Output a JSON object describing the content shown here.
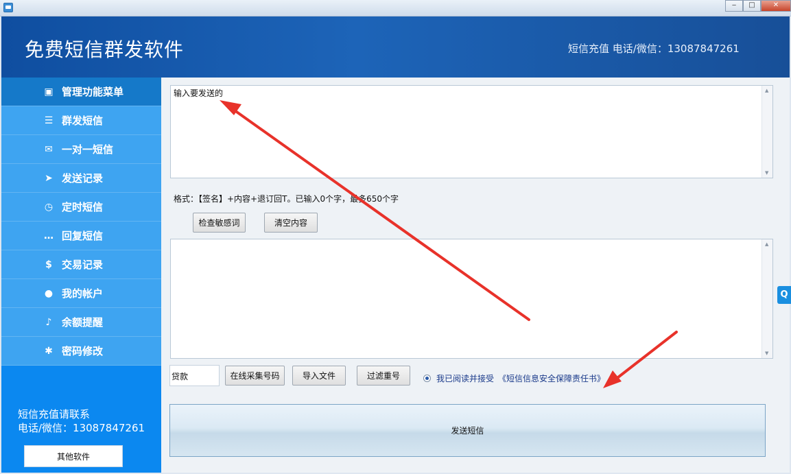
{
  "window": {
    "minimize_label": "‒",
    "maximize_label": "□",
    "close_label": "✕"
  },
  "header": {
    "title": "免费短信群发软件",
    "contact": "短信充值 电话/微信：13087847261"
  },
  "sidebar": {
    "items": [
      {
        "label": "管理功能菜单",
        "icon": "monitor-icon",
        "glyph": "▣"
      },
      {
        "label": "群发短信",
        "icon": "group-chat-icon",
        "glyph": "☰"
      },
      {
        "label": "一对一短信",
        "icon": "user-message-icon",
        "glyph": "✉"
      },
      {
        "label": "发送记录",
        "icon": "send-record-icon",
        "glyph": "➤"
      },
      {
        "label": "定时短信",
        "icon": "timer-icon",
        "glyph": "◷"
      },
      {
        "label": "回复短信",
        "icon": "reply-bubble-icon",
        "glyph": "…"
      },
      {
        "label": "交易记录",
        "icon": "money-bag-icon",
        "glyph": "$"
      },
      {
        "label": "我的帐户",
        "icon": "person-icon",
        "glyph": "●"
      },
      {
        "label": "余额提醒",
        "icon": "bell-icon",
        "glyph": "♪"
      },
      {
        "label": "密码修改",
        "icon": "gear-lock-icon",
        "glyph": "✱"
      }
    ],
    "contact_line1": "短信充值请联系",
    "contact_line2": "电话/微信：13087847261",
    "other_software_label": "其他软件"
  },
  "compose": {
    "message_value": "输入要发送的",
    "format_hint": "格式：【签名】+内容+退订回T。已输入0个字，最多650个字",
    "check_sensitive_label": "检查敏感词",
    "clear_content_label": "清空内容"
  },
  "numbers": {
    "numbers_value": "",
    "filter_input_value": "贷款",
    "online_collect_label": "在线采集号码",
    "import_file_label": "导入文件",
    "dedupe_label": "过滤重号"
  },
  "agreement": {
    "text": "我已阅读并接受",
    "link": "《短信信息安全保障责任书》"
  },
  "send_button_label": "发送短信",
  "edge_tab_label": "Q",
  "colors": {
    "banner": "#1d64b8",
    "sidebar": "#3ea4f1",
    "sidebar_active": "#1579c9",
    "annotation_arrow": "#e8322a"
  }
}
